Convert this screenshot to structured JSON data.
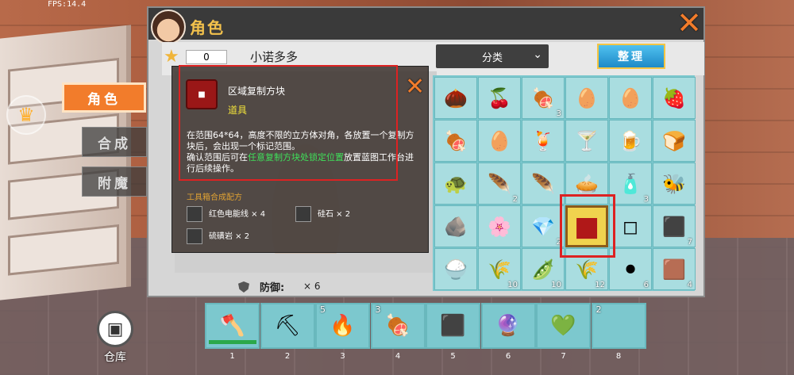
{
  "fps": "FPS:14.4",
  "nav": {
    "crown_icon": "crown-icon",
    "tabs": [
      "角色",
      "合成",
      "附魔"
    ],
    "warehouse_label": "仓库"
  },
  "header": {
    "title": "角色",
    "close_icon": "close-x-icon"
  },
  "player": {
    "score": "0",
    "name": "小诺多多"
  },
  "controls": {
    "category_label": "分类",
    "sort_label": "整理"
  },
  "defense": {
    "label": "防御:",
    "value": "× 6"
  },
  "tooltip": {
    "item_name": "区域复制方块",
    "item_type": "道具",
    "desc_part1": "在范围64*64，高度不限的立方体对角，各放置一个复制方块后，会出现一个标记范围。",
    "desc_part2": "确认范围后可在",
    "desc_highlight": "任意复制方块处锁定位置",
    "desc_part3": "放置蓝图工作台进行后续操作。",
    "recipe_title": "工具箱合成配方",
    "recipe": [
      {
        "name": "红色电能线 × 4"
      },
      {
        "name": "硅石 × 2"
      },
      {
        "name": "硫磺岩 × 2"
      }
    ]
  },
  "inventory": [
    {
      "icon": "acorn-icon",
      "glyph": "🌰",
      "count": ""
    },
    {
      "icon": "cherries-icon",
      "glyph": "🍒",
      "count": ""
    },
    {
      "icon": "meat-leg-icon",
      "glyph": "🍖",
      "count": "3"
    },
    {
      "icon": "egg-black-icon",
      "glyph": "🥚",
      "count": ""
    },
    {
      "icon": "egg-purple-icon",
      "glyph": "🥚",
      "count": ""
    },
    {
      "icon": "strawberry-icon",
      "glyph": "🍓",
      "count": ""
    },
    {
      "icon": "ribs-icon",
      "glyph": "🍖",
      "count": ""
    },
    {
      "icon": "egg-white-icon",
      "glyph": "🥚",
      "count": ""
    },
    {
      "icon": "lemonade-icon",
      "glyph": "🍹",
      "count": ""
    },
    {
      "icon": "cocktail-icon",
      "glyph": "🍸",
      "count": ""
    },
    {
      "icon": "mug-icon",
      "glyph": "🍺",
      "count": ""
    },
    {
      "icon": "bread-icon",
      "glyph": "🍞",
      "count": ""
    },
    {
      "icon": "turtle-icon",
      "glyph": "🐢",
      "count": ""
    },
    {
      "icon": "feather-purple-icon",
      "glyph": "🪶",
      "count": "2"
    },
    {
      "icon": "feather-white-icon",
      "glyph": "🪶",
      "count": ""
    },
    {
      "icon": "pie-icon",
      "glyph": "🥧",
      "count": ""
    },
    {
      "icon": "bottle-icon",
      "glyph": "🧴",
      "count": "3"
    },
    {
      "icon": "bee-icon",
      "glyph": "🐝",
      "count": ""
    },
    {
      "icon": "amber-ore-icon",
      "glyph": "🪨",
      "count": ""
    },
    {
      "icon": "blue-flower-icon",
      "glyph": "🌸",
      "count": ""
    },
    {
      "icon": "crystal-icon",
      "glyph": "💎",
      "count": "2"
    },
    {
      "icon": "copy-block-icon",
      "glyph": "■",
      "count": "",
      "selected": true
    },
    {
      "icon": "stone-block-icon",
      "glyph": "◻",
      "count": ""
    },
    {
      "icon": "coal-ore-icon",
      "glyph": "⬛",
      "count": "7"
    },
    {
      "icon": "rice-bowl-icon",
      "glyph": "🍚",
      "count": ""
    },
    {
      "icon": "wheat-icon",
      "glyph": "🌾",
      "count": "10"
    },
    {
      "icon": "green-seeds-icon",
      "glyph": "🫛",
      "count": "10"
    },
    {
      "icon": "wheat-bundle-icon",
      "glyph": "🌾",
      "count": "12"
    },
    {
      "icon": "black-orb-icon",
      "glyph": "⚫",
      "count": "6"
    },
    {
      "icon": "dirt-block-icon",
      "glyph": "🟫",
      "count": "4"
    }
  ],
  "hotbar": [
    {
      "icon": "axe-icon",
      "glyph": "🪓",
      "count": "",
      "num": "1"
    },
    {
      "icon": "pickaxe-icon",
      "glyph": "⛏",
      "count": "",
      "num": "2"
    },
    {
      "icon": "torch-icon",
      "glyph": "🔥",
      "count": "5",
      "num": "3"
    },
    {
      "icon": "meat-icon",
      "glyph": "🍖",
      "count": "3",
      "num": "4"
    },
    {
      "icon": "dark-block-icon",
      "glyph": "⬛",
      "count": "",
      "num": "5"
    },
    {
      "icon": "purple-ore-icon",
      "glyph": "🔮",
      "count": "",
      "num": "6"
    },
    {
      "icon": "green-gem-icon",
      "glyph": "💚",
      "count": "",
      "num": "7"
    },
    {
      "icon": "empty-slot-icon",
      "glyph": "",
      "count": "2",
      "num": "8"
    }
  ],
  "colors": {
    "accent_orange": "#f27c2b",
    "grid_teal": "#7cc8ce",
    "highlight_red": "#d22222",
    "text_green": "#3fe05a",
    "text_yellow": "#f1e13a"
  }
}
